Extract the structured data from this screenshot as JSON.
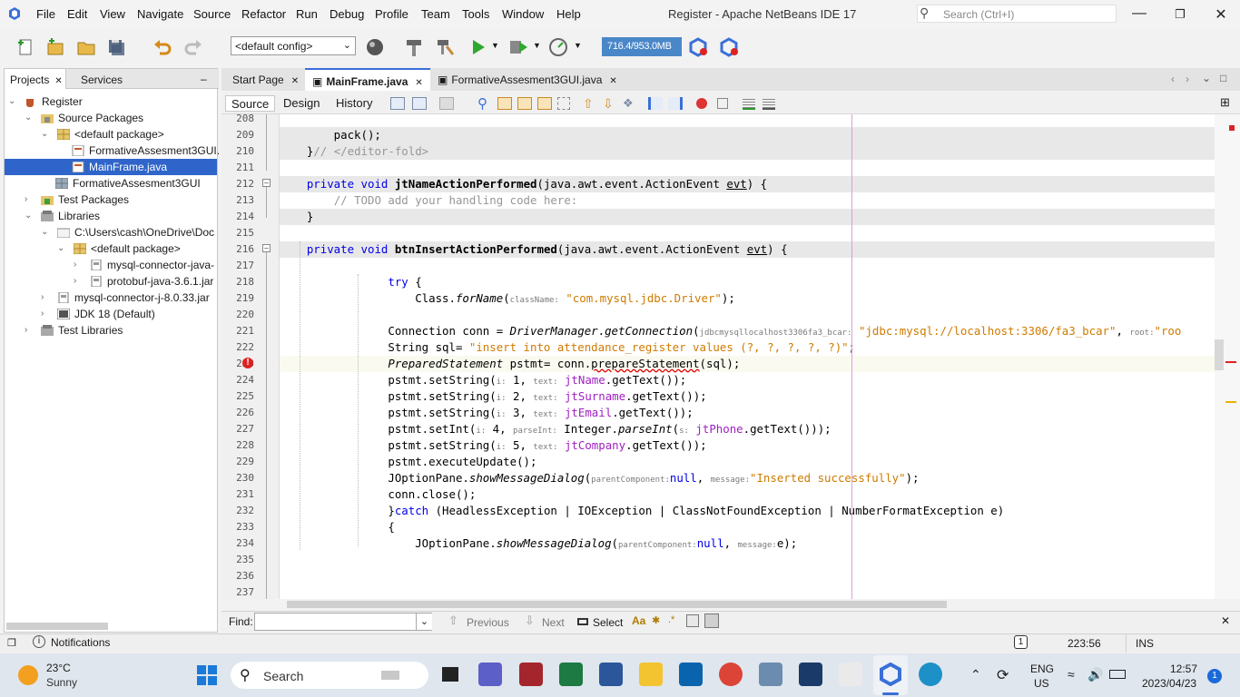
{
  "window": {
    "title": "Register - Apache NetBeans IDE 17"
  },
  "menu": [
    "File",
    "Edit",
    "View",
    "Navigate",
    "Source",
    "Refactor",
    "Run",
    "Debug",
    "Profile",
    "Team",
    "Tools",
    "Window",
    "Help"
  ],
  "search": {
    "placeholder": "Search (Ctrl+I)"
  },
  "toolbar": {
    "config": "<default config>",
    "memory": "716.4/953.0MB"
  },
  "left_panel": {
    "tabs": [
      "Projects",
      "Services"
    ],
    "tree": [
      {
        "label": "Register",
        "level": 0
      },
      {
        "label": "Source Packages",
        "level": 1
      },
      {
        "label": "<default package>",
        "level": 2
      },
      {
        "label": "FormativeAssesment3GUI.",
        "level": 3
      },
      {
        "label": "MainFrame.java",
        "level": 3,
        "selected": true
      },
      {
        "label": "FormativeAssesment3GUI",
        "level": 2
      },
      {
        "label": "Test Packages",
        "level": 1
      },
      {
        "label": "Libraries",
        "level": 1
      },
      {
        "label": "C:\\Users\\cash\\OneDrive\\Doc",
        "level": 2
      },
      {
        "label": "<default package>",
        "level": 3
      },
      {
        "label": "mysql-connector-java-",
        "level": 4
      },
      {
        "label": "protobuf-java-3.6.1.jar",
        "level": 4
      },
      {
        "label": "mysql-connector-j-8.0.33.jar",
        "level": 2
      },
      {
        "label": "JDK 18 (Default)",
        "level": 2
      },
      {
        "label": "Test Libraries",
        "level": 1
      }
    ]
  },
  "editor_tabs": [
    "Start Page",
    "MainFrame.java",
    "FormativeAssesment3GUI.java"
  ],
  "editor_modes": [
    "Source",
    "Design",
    "History"
  ],
  "line_numbers": [
    "208",
    "209",
    "210",
    "211",
    "212",
    "213",
    "214",
    "215",
    "216",
    "217",
    "218",
    "219",
    "220",
    "221",
    "222",
    "223",
    "224",
    "225",
    "226",
    "227",
    "228",
    "229",
    "230",
    "231",
    "232",
    "233",
    "234",
    "235",
    "236",
    "237"
  ],
  "findbar": {
    "label": "Find:",
    "previous": "Previous",
    "next": "Next",
    "select": "Select"
  },
  "status": {
    "notifications": "Notifications",
    "badge": "1",
    "position": "223:56",
    "mode": "INS"
  },
  "taskbar": {
    "weather_temp": "23°C",
    "weather_desc": "Sunny",
    "search": "Search",
    "lang1": "ENG",
    "lang2": "US",
    "time": "12:57",
    "date": "2023/04/23",
    "notif_count": "1"
  }
}
